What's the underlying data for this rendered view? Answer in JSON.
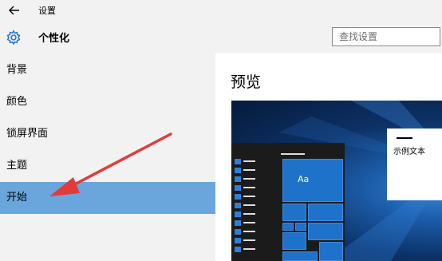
{
  "titlebar": {
    "title": "设置",
    "back_icon": "back-arrow-icon"
  },
  "header": {
    "icon": "gear-icon",
    "title": "个性化",
    "search": {
      "placeholder": "查找设置",
      "value": ""
    }
  },
  "sidebar": {
    "items": [
      {
        "label": "背景",
        "selected": false
      },
      {
        "label": "颜色",
        "selected": false
      },
      {
        "label": "锁屏界面",
        "selected": false
      },
      {
        "label": "主题",
        "selected": false
      },
      {
        "label": "开始",
        "selected": true
      }
    ]
  },
  "main": {
    "section_title": "预览",
    "preview": {
      "tile_label": "Aa",
      "sample_window_text": "示例文本"
    }
  },
  "annotation": {
    "arrow_color": "#e23b3b"
  },
  "colors": {
    "selected": "#6aa6dc",
    "accent": "#1e72c9",
    "sidebar_bg": "#f2f2f2"
  }
}
